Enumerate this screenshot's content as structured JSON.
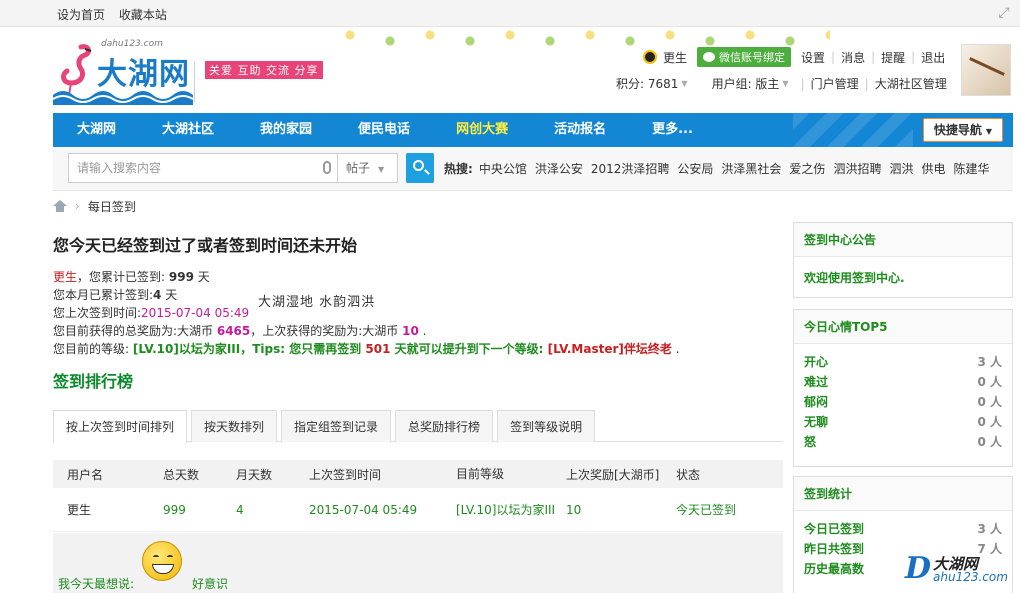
{
  "topbar": {
    "links": [
      "设为首页",
      "收藏本站"
    ],
    "expand_icon": "⤢"
  },
  "logo": {
    "domain": "dahu123.com",
    "name": "大湖网"
  },
  "slogan": {
    "main": "大湖湿地 水韵泗洪",
    "tags": "关爱 互助 交流 分享"
  },
  "user": {
    "name": "更生",
    "wx_bind": "微信账号绑定",
    "links": [
      "设置",
      "消息",
      "提醒",
      "退出"
    ],
    "points_label": "积分: 7681",
    "group_label": "用户组: 版主",
    "admin_links": [
      "门户管理",
      "大湖社区管理"
    ]
  },
  "nav": {
    "items": [
      "大湖网",
      "大湖社区",
      "我的家园",
      "便民电话",
      "网创大赛",
      "活动报名",
      "更多..."
    ],
    "highlight_index": 4,
    "quick_nav": "快捷导航"
  },
  "search": {
    "placeholder": "请输入搜索内容",
    "type": "帖子",
    "hot_label": "热搜:",
    "hot_keywords": [
      "中央公馆",
      "洪泽公安",
      "2012洪泽招聘",
      "公安局",
      "洪泽黑社会",
      "爱之伤",
      "泗洪招聘",
      "泗洪",
      "供电",
      "陈建华"
    ]
  },
  "breadcrumb": {
    "current": "每日签到"
  },
  "signin": {
    "heading": "您今天已经签到过了或者签到时间还未开始",
    "user": "更生",
    "total_text": "，您累计已签到: ",
    "total_days": "999",
    "day_unit": " 天",
    "month_text": "您本月已累计签到:",
    "month_days": "4",
    "last_text": "您上次签到时间:",
    "last_time": "2015-07-04 05:49",
    "reward_text": "您目前获得的总奖励为:大湖币 ",
    "reward_total": "6465",
    "reward_last_text": "，上次获得的奖励为:大湖币 ",
    "reward_last": "10",
    "level_text": "您目前的等级: ",
    "level": "[LV.10]以坛为家III",
    "tips_text": "，Tips: 您只需再签到 ",
    "tips_days": "501",
    "tips_text2": " 天就可以提升到下一个等级: ",
    "next_level": "[LV.Master]伴坛终老"
  },
  "ranking": {
    "title": "签到排行榜",
    "tabs": [
      "按上次签到时间排列",
      "按天数排列",
      "指定组签到记录",
      "总奖励排行榜",
      "签到等级说明"
    ],
    "columns": [
      "用户名",
      "总天数",
      "月天数",
      "上次签到时间",
      "目前等级",
      "上次奖励[大湖币]",
      "状态"
    ],
    "rows": [
      {
        "user": "更生",
        "total": "999",
        "month": "4",
        "last": "2015-07-04 05:49",
        "level": "[LV.10]以坛为家III",
        "reward": "10",
        "status": "今天已签到"
      }
    ]
  },
  "mood": {
    "label": "我今天最想说:",
    "text": "好意识"
  },
  "sidebar": {
    "notice": {
      "title": "签到中心公告",
      "body": "欢迎使用签到中心."
    },
    "mood_top": {
      "title": "今日心情TOP5",
      "items": [
        {
          "name": "开心",
          "value": "3 人"
        },
        {
          "name": "难过",
          "value": "0 人"
        },
        {
          "name": "郁闷",
          "value": "0 人"
        },
        {
          "name": "无聊",
          "value": "0 人"
        },
        {
          "name": "怒",
          "value": "0 人"
        }
      ]
    },
    "stats": {
      "title": "签到统计",
      "items": [
        {
          "name": "今日已签到",
          "value": "3 人"
        },
        {
          "name": "昨日共签到",
          "value": "7 人"
        },
        {
          "name": "历史最高数",
          "value": ""
        }
      ]
    }
  },
  "watermark": {
    "letter": "D",
    "name": "大湖网",
    "domain": "ahu123.com"
  },
  "colors": {
    "nav_blue": "#1487d4",
    "accent_green": "#1e8c1e",
    "highlight_red": "#c81e1e",
    "magenta": "#c8199b"
  }
}
